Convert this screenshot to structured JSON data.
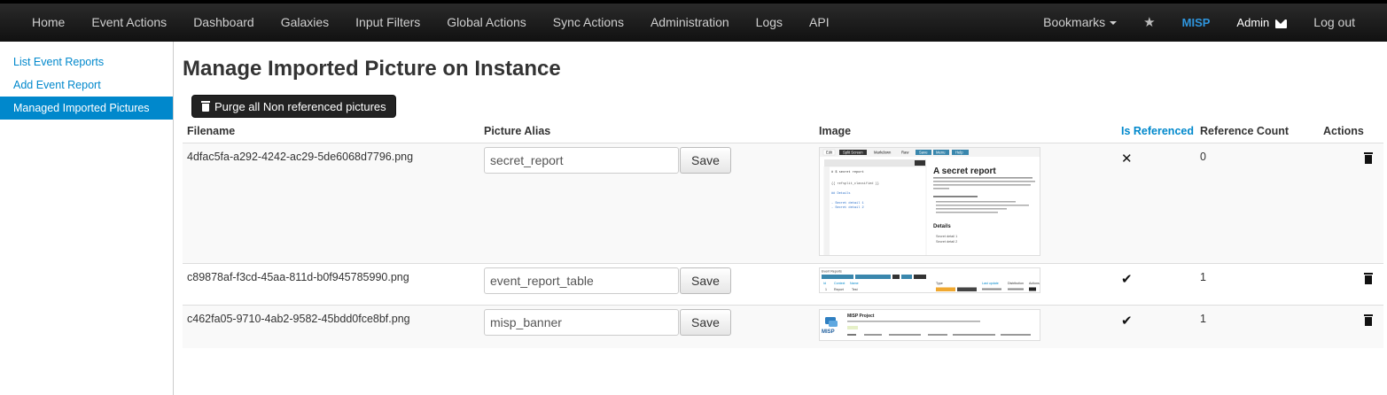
{
  "navbar": {
    "left": [
      "Home",
      "Event Actions",
      "Dashboard",
      "Galaxies",
      "Input Filters",
      "Global Actions",
      "Sync Actions",
      "Administration",
      "Logs",
      "API"
    ],
    "bookmarks": "Bookmarks",
    "misp": "MISP",
    "admin": "Admin",
    "logout": "Log out"
  },
  "sidebar": {
    "items": [
      {
        "label": "List Event Reports"
      },
      {
        "label": "Add Event Report"
      },
      {
        "label": "Managed Imported Pictures"
      }
    ]
  },
  "page": {
    "title": "Manage Imported Picture on Instance",
    "purge_label": "Purge all Non referenced pictures"
  },
  "table": {
    "headers": {
      "filename": "Filename",
      "alias": "Picture Alias",
      "image": "Image",
      "referenced": "Is Referenced",
      "count": "Reference Count",
      "actions": "Actions"
    },
    "rows": [
      {
        "filename": "4dfac5fa-a292-4242-ac29-5de6068d7796.png",
        "alias": "secret_report",
        "save": "Save",
        "referenced": false,
        "count": "0"
      },
      {
        "filename": "c89878af-f3cd-45aa-811d-b0f945785990.png",
        "alias": "event_report_table",
        "save": "Save",
        "referenced": true,
        "count": "1"
      },
      {
        "filename": "c462fa05-9710-4ab2-9582-45bdd0fce8bf.png",
        "alias": "misp_banner",
        "save": "Save",
        "referenced": true,
        "count": "1"
      }
    ]
  },
  "thumbnails": {
    "t1": {
      "tabs": [
        "Edit",
        "Split Screen",
        "Markdown",
        "Raw",
        "Save",
        "Menu",
        "Help"
      ],
      "md_lines": [
        "# $ secret report",
        "",
        "{{ refsplit_classified }}",
        "",
        "## Details",
        "",
        "- Secret detail 1",
        "- Secret detail 2"
      ],
      "heading": "A secret report",
      "sub1": "Details",
      "items": [
        "Secret detail 1",
        "Secret detail 2"
      ]
    },
    "t2": {
      "title": "Event Reports",
      "cols": [
        "Id",
        "Context",
        "Name",
        "Type",
        "Last update",
        "Distribution",
        "Actions"
      ],
      "row": [
        "1",
        "Report",
        "Test"
      ]
    },
    "t3": {
      "logo": "MISP",
      "title": "MISP Project"
    }
  }
}
